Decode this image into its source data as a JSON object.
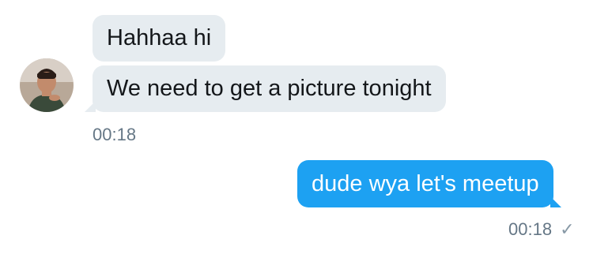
{
  "conversation": {
    "received": {
      "messages": [
        {
          "text": "Hahhaa hi"
        },
        {
          "text": "We need to get a picture tonight"
        }
      ],
      "timestamp": "00:18",
      "avatar_icon": "user-avatar-icon"
    },
    "sent": {
      "messages": [
        {
          "text": "dude wya let's meetup"
        }
      ],
      "timestamp": "00:18",
      "status_icon": "checkmark-icon"
    }
  },
  "colors": {
    "received_bubble": "#e6ecf0",
    "sent_bubble": "#1da1f2",
    "timestamp_text": "#657786"
  }
}
